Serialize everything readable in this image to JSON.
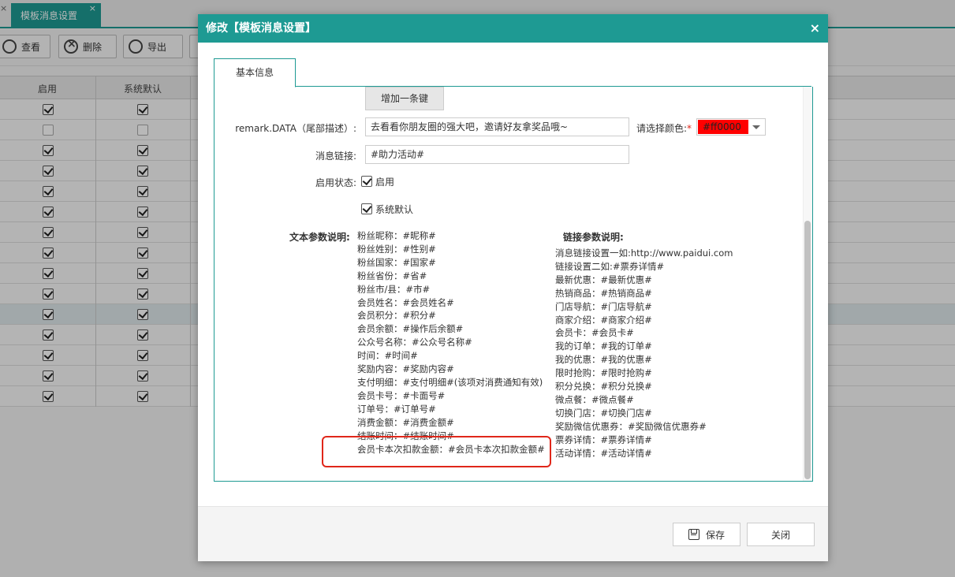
{
  "background": {
    "tab_title": "模板消息设置",
    "toolbar": {
      "view_label": "查看",
      "delete_label": "删除",
      "export_label": "导出"
    },
    "table": {
      "col_enabled": "启用",
      "col_default": "系统默认",
      "rows": [
        {
          "enabled": true,
          "default": true
        },
        {
          "enabled": false,
          "default": false
        },
        {
          "enabled": true,
          "default": true
        },
        {
          "enabled": true,
          "default": true
        },
        {
          "enabled": true,
          "default": true
        },
        {
          "enabled": true,
          "default": true
        },
        {
          "enabled": true,
          "default": true
        },
        {
          "enabled": true,
          "default": true
        },
        {
          "enabled": true,
          "default": true
        },
        {
          "enabled": true,
          "default": true
        },
        {
          "enabled": true,
          "default": true
        },
        {
          "enabled": true,
          "default": true
        },
        {
          "enabled": true,
          "default": true
        },
        {
          "enabled": true,
          "default": true
        },
        {
          "enabled": true,
          "default": true
        }
      ]
    }
  },
  "dialog": {
    "title": "修改【模板消息设置】",
    "close_glyph": "×",
    "tab_label": "基本信息",
    "add_button": "增加一条键",
    "remark_label": "remark.DATA（尾部描述）:",
    "remark_value": "去看看你朋友圈的强大吧，邀请好友拿奖品哦~",
    "color_label": "请选择颜色:",
    "color_required": "*",
    "color_value": "#ff0000",
    "link_label": "消息链接:",
    "link_value": "#助力活动#",
    "status_label": "启用状态:",
    "enabled_label": "启用",
    "default_label": "系统默认",
    "text_params_title": "文本参数说明:",
    "text_params": [
      "粉丝昵称：#昵称#",
      "粉丝姓别：#性别#",
      "粉丝国家：#国家#",
      "粉丝省份：#省#",
      "粉丝市/县：#市#",
      "会员姓名：#会员姓名#",
      "会员积分：#积分#",
      "会员余额：#操作后余额#",
      "公众号名称：#公众号名称#",
      "时间：#时间#",
      "奖励内容：#奖励内容#",
      "支付明细：#支付明细#(该项对消费通知有效)",
      "会员卡号：#卡面号#",
      "订单号：#订单号#",
      "消费金额：#消费金额#",
      "结账时间：#结账时间#",
      "会员卡本次扣款金额：#会员卡本次扣款金额#"
    ],
    "link_params_title": "链接参数说明:",
    "link_params": [
      "消息链接设置一如:http://www.paidui.com",
      "链接设置二如:#票券详情#",
      "最新优惠：#最新优惠#",
      "热销商品：#热销商品#",
      "门店导航：#门店导航#",
      "商家介绍：#商家介绍#",
      "会员卡：#会员卡#",
      "我的订单：#我的订单#",
      "我的优惠：#我的优惠#",
      "限时抢购：#限时抢购#",
      "积分兑换：#积分兑换#",
      "微点餐：#微点餐#",
      "切换门店：#切换门店#",
      "奖励微信优惠券：#奖励微信优惠券#",
      "票券详情：#票券详情#",
      "活动详情：#活动详情#"
    ],
    "save_button": "保存",
    "close_button": "关闭"
  }
}
